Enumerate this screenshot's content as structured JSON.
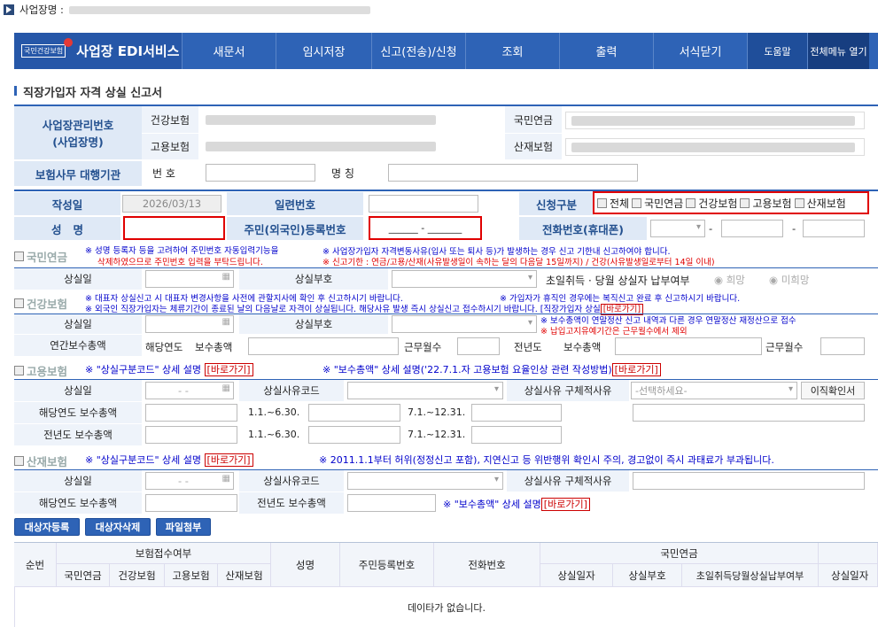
{
  "topbar": {
    "label": "사업장명 :"
  },
  "nav": {
    "brand_small": "국민건강보험",
    "brand": "사업장 EDI서비스",
    "items": [
      "새문서",
      "임시저장",
      "신고(전송)/신청",
      "조회",
      "출력",
      "서식닫기"
    ],
    "help": "도움말",
    "all_menu": "전체메뉴 열기"
  },
  "page_title": "직장가입자 자격 상실 신고서",
  "biz": {
    "label": "사업장관리번호\n(사업장명)",
    "health": "건강보험",
    "pension": "국민연금",
    "employment": "고용보험",
    "industrial": "산재보험",
    "agent": "보험사무 대행기관",
    "number": "번 호",
    "name": "명 칭"
  },
  "form": {
    "write_date_label": "작성일",
    "write_date": "2026/03/13",
    "serial_label": "일련번호",
    "apply_label": "신청구분",
    "apply_opts": [
      "전체",
      "국민연금",
      "건강보험",
      "고용보험",
      "산재보험"
    ],
    "name_label": "성   명",
    "rrn_label": "주민(외국인)등록번호",
    "rrn_value": "______ - _______",
    "phone_label": "전화번호(휴대폰)",
    "dash": "-"
  },
  "pension": {
    "title": "국민연금",
    "note1": "※ 성명 등록자 등을 고려하여 주민번호 자동입력기능을",
    "note1b": "삭제하였으므로 주민번호 입력을 부탁드립니다.",
    "note2": "※ 사업장가입자 자격변동사유(입사 또는 퇴사 등)가 발생하는 경우 신고 기한내 신고하여야 합니다.",
    "note3": "※ 신고기한 : 연금/고용/산재(사유발생일이 속하는 달의 다음달 15일까지) / 건강(사유발생일로부터 14일 이내)",
    "loss_date": "상실일",
    "loss_code": "상실부호",
    "first_month": "초일취득 · 당월 상실자 납부여부",
    "hope": "희망",
    "nohope": "미희망"
  },
  "health": {
    "title": "건강보험",
    "note1": "※ 대표자 상실신고 시 대표자 변경사항을 사전에 관할지사에 확인 후 신고하시기 바랍니다.",
    "note2": "※ 가입자가 휴직인 경우에는 복직신고 완료 후 신고하시기 바랍니다.",
    "note3": "※ 외국인 직장가입자는 체류기간이 종료된 날의 다음날로 자격이 상실됩니다. 해당사유 발생 즉시 상실신고 접수하시기 바랍니다. [직장가입자 상실",
    "goto": "[바로가기]",
    "loss_date": "상실일",
    "loss_code": "상실부호",
    "note4": "※ 보수총액이 연말정산 신고 내역과 다른 경우 연말정산 재정산으로 접수",
    "note5": "※ 납입고지유예기간은 근무월수에서 제외",
    "annual_total": "연간보수총액",
    "this_year": "해당연도",
    "total": "보수총액",
    "months": "근무월수",
    "prev_year": "전년도"
  },
  "employment": {
    "title": "고용보험",
    "note1": "※ \"상실구분코드\" 상세 설명",
    "goto": "[바로가기]",
    "note2": "※ \"보수총액\" 상세 설명('22.7.1.자 고용보험 요율인상 관련 작성방법)",
    "loss_date": "상실일",
    "reason_code": "상실사유코드",
    "reason_detail": "상실사유 구체적사유",
    "select_ph": "-선택하세요-",
    "confirm_btn": "이직확인서",
    "this_year_total": "해당연도 보수총액",
    "prev_year_total": "전년도 보수총액",
    "p1": "1.1.~6.30.",
    "p2": "7.1.~12.31.",
    "date_ph": "- -"
  },
  "industrial": {
    "title": "산재보험",
    "note1": "※ \"상실구분코드\" 상세 설명",
    "goto": "[바로가기]",
    "note2": "※ 2011.1.1부터 허위(정정신고 포함), 지연신고 등 위반행위 확인시 주의, 경고없이 즉시 과태료가 부과됩니다.",
    "loss_date": "상실일",
    "reason_code": "상실사유코드",
    "reason_detail": "상실사유 구체적사유",
    "this_year_total": "해당연도 보수총액",
    "prev_year_total": "전년도 보수총액",
    "note3": "※ \"보수총액\" 상세 설명"
  },
  "buttons": {
    "add": "대상자등록",
    "del": "대상자삭제",
    "attach": "파일첨부"
  },
  "grid": {
    "seq": "순번",
    "accept": "보험접수여부",
    "pension": "국민연금",
    "health": "건강보험",
    "employment": "고용보험",
    "industrial": "산재보험",
    "name": "성명",
    "rrn": "주민등록번호",
    "phone": "전화번호",
    "pension_group": "국민연금",
    "loss_date": "상실일자",
    "loss_code": "상실부호",
    "first_month": "초일취득당월상실납부여부",
    "loss_date2": "상실일자",
    "empty": "데이타가 없습니다."
  }
}
